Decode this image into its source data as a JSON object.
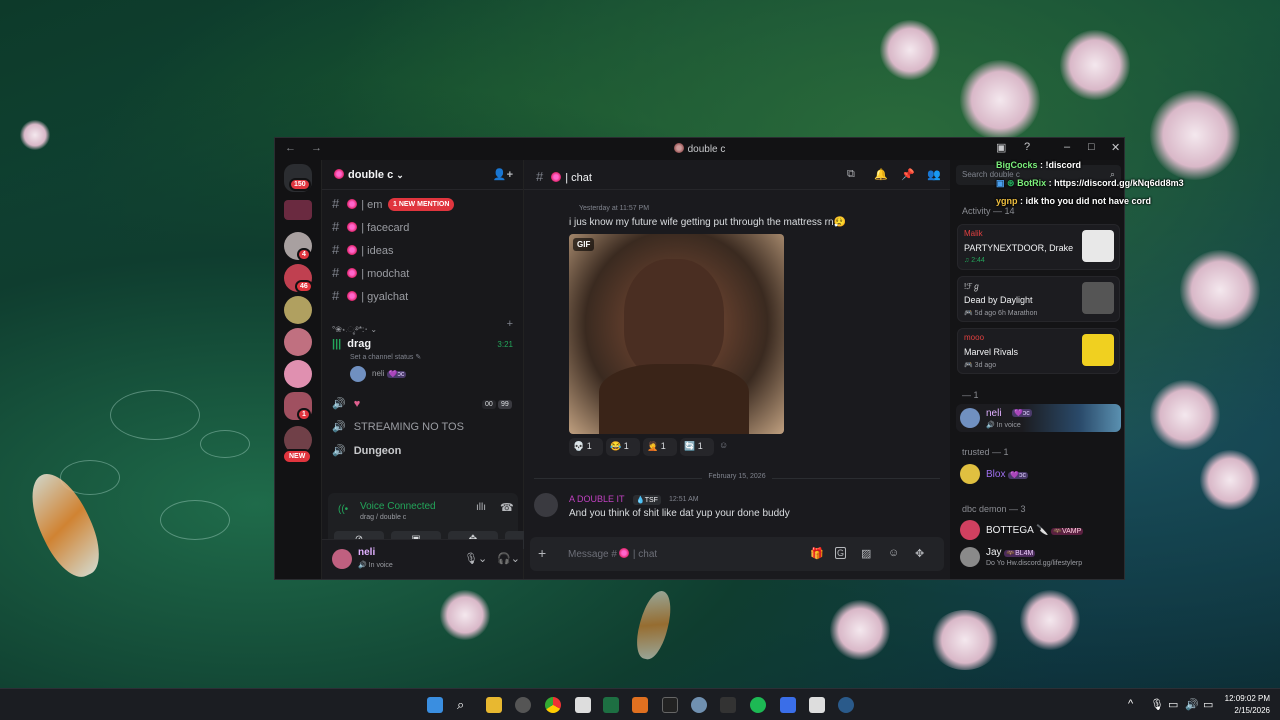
{
  "window": {
    "title": "double c"
  },
  "server_rail": {
    "badges": [
      "150",
      "4",
      "46",
      "1"
    ],
    "new_label": "NEW"
  },
  "sidebar": {
    "server_name": "double c",
    "mention_pill": "1 NEW MENTION",
    "channels": [
      "| em",
      "| facecard",
      "| ideas",
      "| modchat",
      "| gyalchat"
    ],
    "voice_category": "°❀⋆.ೃ࿔*:･",
    "voice_channel": {
      "name": "drag",
      "timer": "3:21",
      "status_placeholder": "Set a channel status",
      "member": "neli",
      "member_tag": "ɔc"
    },
    "voice_channel_2": {
      "users_count": "00",
      "limit": "99"
    },
    "voice_channel_3": "STREAMING NO TOS",
    "voice_channel_4": "Dungeon",
    "voice_connected": {
      "label": "Voice Connected",
      "location": "drag / double c"
    },
    "user": {
      "name": "neli",
      "status": "In voice"
    }
  },
  "chat": {
    "channel_name": "| chat",
    "message1": {
      "time": "Yesterday at 11:57 PM",
      "text": "i jus know my future wife getting put through the mattress rn😮‍💨",
      "gif_label": "GIF"
    },
    "reactions": [
      {
        "emoji": "💀",
        "count": "1"
      },
      {
        "emoji": "😂",
        "count": "1"
      },
      {
        "emoji": "🤦",
        "count": "1"
      },
      {
        "emoji": "🔄",
        "count": "1"
      }
    ],
    "date_divider": "February 15, 2026",
    "message2": {
      "author": "A DOUBLE IT",
      "tag": "TSF",
      "time": "12:51 AM",
      "text": "And you think of shit like dat yup your done buddy"
    },
    "composer_placeholder": "Message #",
    "composer_channel": "| chat"
  },
  "right_panel": {
    "search_placeholder": "Search double c",
    "activity_header": "Activity — 14",
    "activities": [
      {
        "user": "Malik",
        "title": "PARTYNEXTDOOR, Drake",
        "sub": "2:44"
      },
      {
        "user": "!ℱℊ",
        "title": "Dead by Daylight",
        "sub": "5d ago",
        "sub2": "6h Marathon"
      },
      {
        "user": "mooo",
        "title": "Marvel Rivals",
        "sub": "3d ago"
      }
    ],
    "group1_header": "— 1",
    "neli": {
      "name": "neli",
      "tag": "ɔc",
      "status": "In voice"
    },
    "trusted_header": "trusted — 1",
    "trusted_member": {
      "name": "Blox",
      "tag": "ɔc"
    },
    "demon_header": "dbc demon — 3",
    "demon_members": [
      {
        "name": "BOTTEGA",
        "tag": "VAMP"
      },
      {
        "name": "Jay",
        "tag": "BL4M",
        "status": "Do Yo Hw.discord.gg/lifestylerp"
      }
    ]
  },
  "overlay_chat": [
    {
      "user": "BigCocks",
      "msg": ": !discord",
      "color": "#7cf07c"
    },
    {
      "user": "BotRix",
      "msg": ": https://discord.gg/kNq6dd8m3",
      "color": "#7cf07c"
    },
    {
      "user": "ygnp",
      "msg": ": idk tho you did not have cord",
      "color": "#f0c040"
    }
  ],
  "taskbar": {
    "time": "12:09:02 PM",
    "date": "2/15/2026"
  },
  "colors": {
    "accent": "#5865f2",
    "mention": "#e0353e",
    "green": "#23a55a"
  }
}
